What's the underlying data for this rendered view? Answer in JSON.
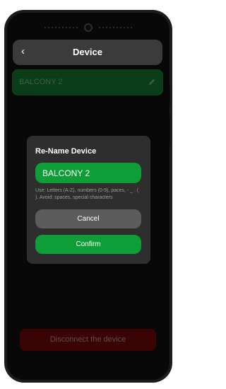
{
  "header": {
    "back_glyph": "‹",
    "title": "Device"
  },
  "device": {
    "name": "BALCONY 2",
    "edit_icon": "pencil-icon"
  },
  "dialog": {
    "title": "Re-Name Device",
    "input_value": "BALCONY 2",
    "hint": "Use: Letters (A-Z), numbers (0-9), paces, - _ . ( ). Avoid: spaces, special characters",
    "cancel_label": "Cancel",
    "confirm_label": "Confirm"
  },
  "footer": {
    "disconnect_label": "Disconnect the device"
  },
  "colors": {
    "accent_green": "#0e9d37",
    "card_green_dimmed": "#0c3d19",
    "disconnect_red_dimmed": "#3a0404",
    "dialog_bg": "#2e2e2e"
  }
}
